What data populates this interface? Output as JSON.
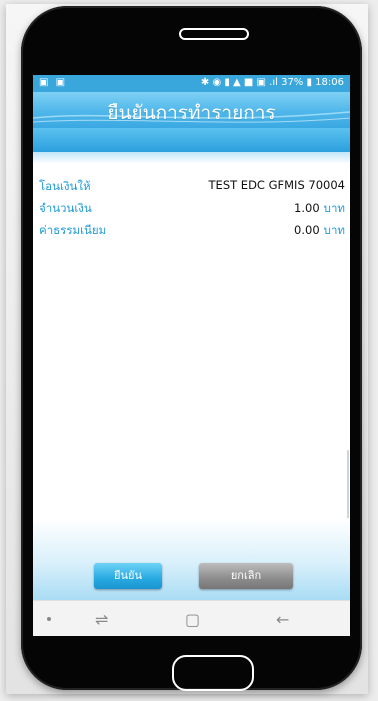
{
  "statusbar": {
    "left_icons": "▣ ▣",
    "right_text": "✱ ◉ ▮ ▲ ■ ▣ .ıl 37% ▮ 18:06"
  },
  "header": {
    "title": "ยืนยันการทำรายการ"
  },
  "details": [
    {
      "label": "โอนเงินให้",
      "value": "TEST EDC GFMIS 70004",
      "unit": ""
    },
    {
      "label": "จำนวนเงิน",
      "value": "1.00",
      "unit": "บาท"
    },
    {
      "label": "ค่าธรรมเนียม",
      "value": "0.00",
      "unit": "บาท"
    }
  ],
  "buttons": {
    "confirm": "ยืนยัน",
    "cancel": "ยกเลิก"
  },
  "navbar": {
    "recent_icon": "⇌",
    "home_icon": "▢",
    "back_icon": "←"
  },
  "colors": {
    "accent": "#2aa5e0",
    "label_blue": "#1f9ad8",
    "cancel_gray": "#8c8c8c"
  }
}
